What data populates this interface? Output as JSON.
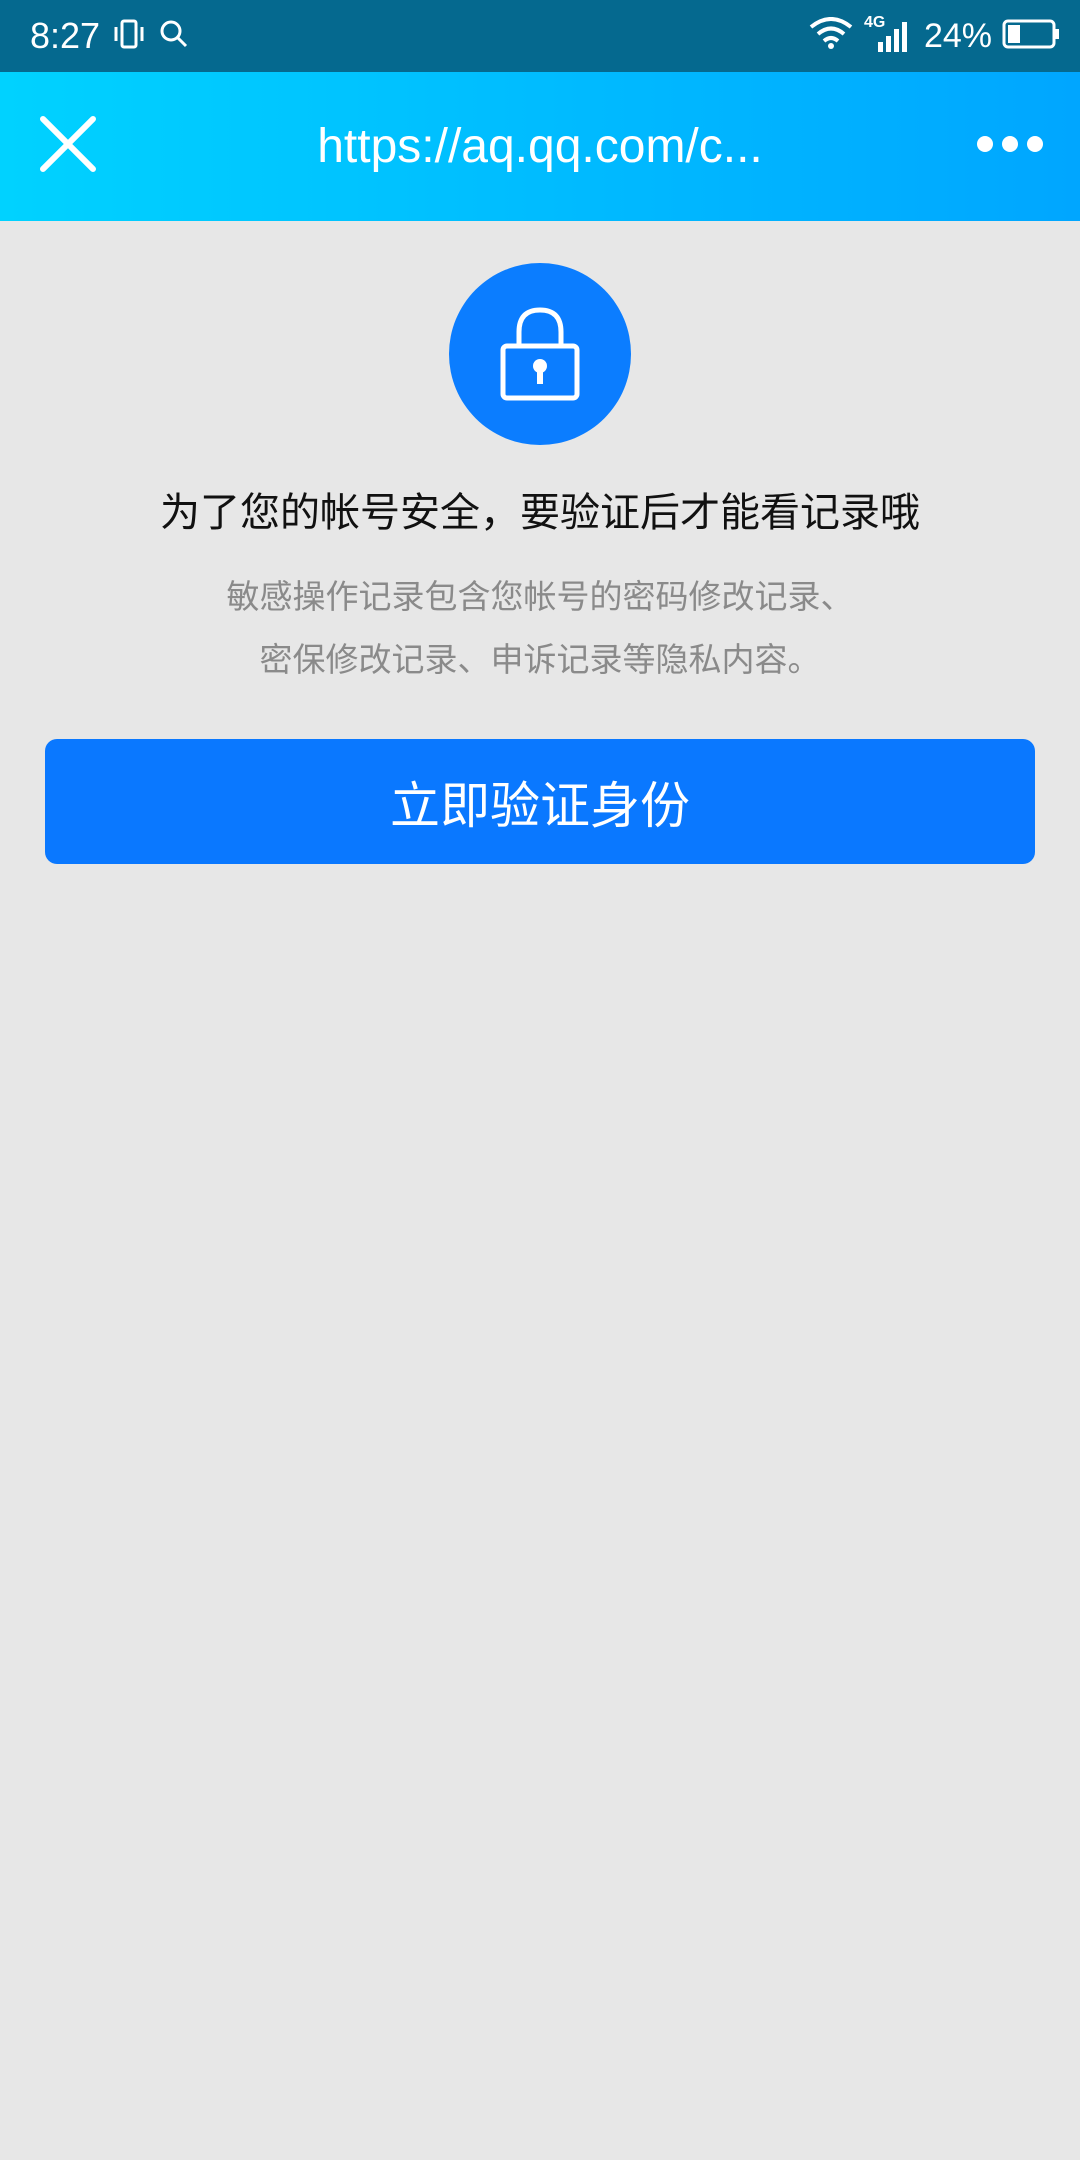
{
  "status_bar": {
    "time": "8:27",
    "battery": "24%",
    "network": "4G"
  },
  "title_bar": {
    "url": "https://aq.qq.com/c..."
  },
  "content": {
    "heading": "为了您的帐号安全，要验证后才能看记录哦",
    "desc_line1": "敏感操作记录包含您帐号的密码修改记录、",
    "desc_line2": "密保修改记录、申诉记录等隐私内容。",
    "button_label": "立即验证身份"
  },
  "colors": {
    "status_bg": "#05698f",
    "accent": "#0a78ff",
    "page_bg": "#e7e7e7"
  }
}
